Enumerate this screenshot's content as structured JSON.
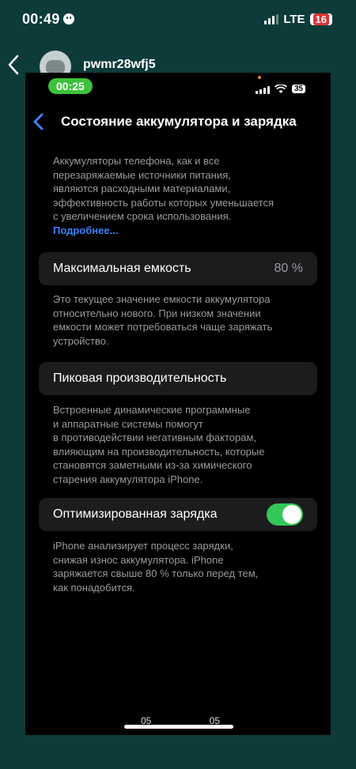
{
  "outer_status": {
    "time": "00:49",
    "network": "LTE",
    "battery": "16"
  },
  "chat": {
    "contact_name": "pwmr28wfj5"
  },
  "recording": {
    "timer": "00:25"
  },
  "inner_status": {
    "battery": "35"
  },
  "nav": {
    "title": "Состояние аккумулятора и зарядка"
  },
  "intro": {
    "lines": [
      "Аккумуляторы телефона, как и все",
      "перезаряжаемые источники питания,",
      "являются расходными материалами,",
      "эффективность работы которых уменьшается",
      "с увеличением срока использования."
    ],
    "link": "Подробнее..."
  },
  "max_capacity": {
    "label": "Максимальная емкость",
    "value": "80 %",
    "footer_lines": [
      "Это текущее значение емкости аккумулятора",
      "относительно нового. При низком значении",
      "емкости может потребоваться чаще заряжать",
      "устройство."
    ]
  },
  "peak_performance": {
    "label": "Пиковая производительность",
    "footer_lines": [
      "Встроенные динамические программные",
      "и аппаратные системы помогут",
      "в противодействии негативным факторам,",
      "влияющим на производительность, которые",
      "становятся заметными из-за химического",
      "старения аккумулятора iPhone."
    ]
  },
  "optimized_charging": {
    "label": "Оптимизированная зарядка",
    "enabled": true,
    "footer_lines": [
      "iPhone анализирует процесс зарядки,",
      "снижая износ аккумулятора. iPhone",
      "заряжается свыше 80 % только перед тем,",
      "как понадобится."
    ]
  },
  "bottom": {
    "left": "05",
    "right": "05"
  },
  "colors": {
    "outer_bg": "#0d3b3a",
    "accent": "#3b82f6",
    "toggle_on": "#33c759",
    "rec_pill": "#3dc23d"
  }
}
